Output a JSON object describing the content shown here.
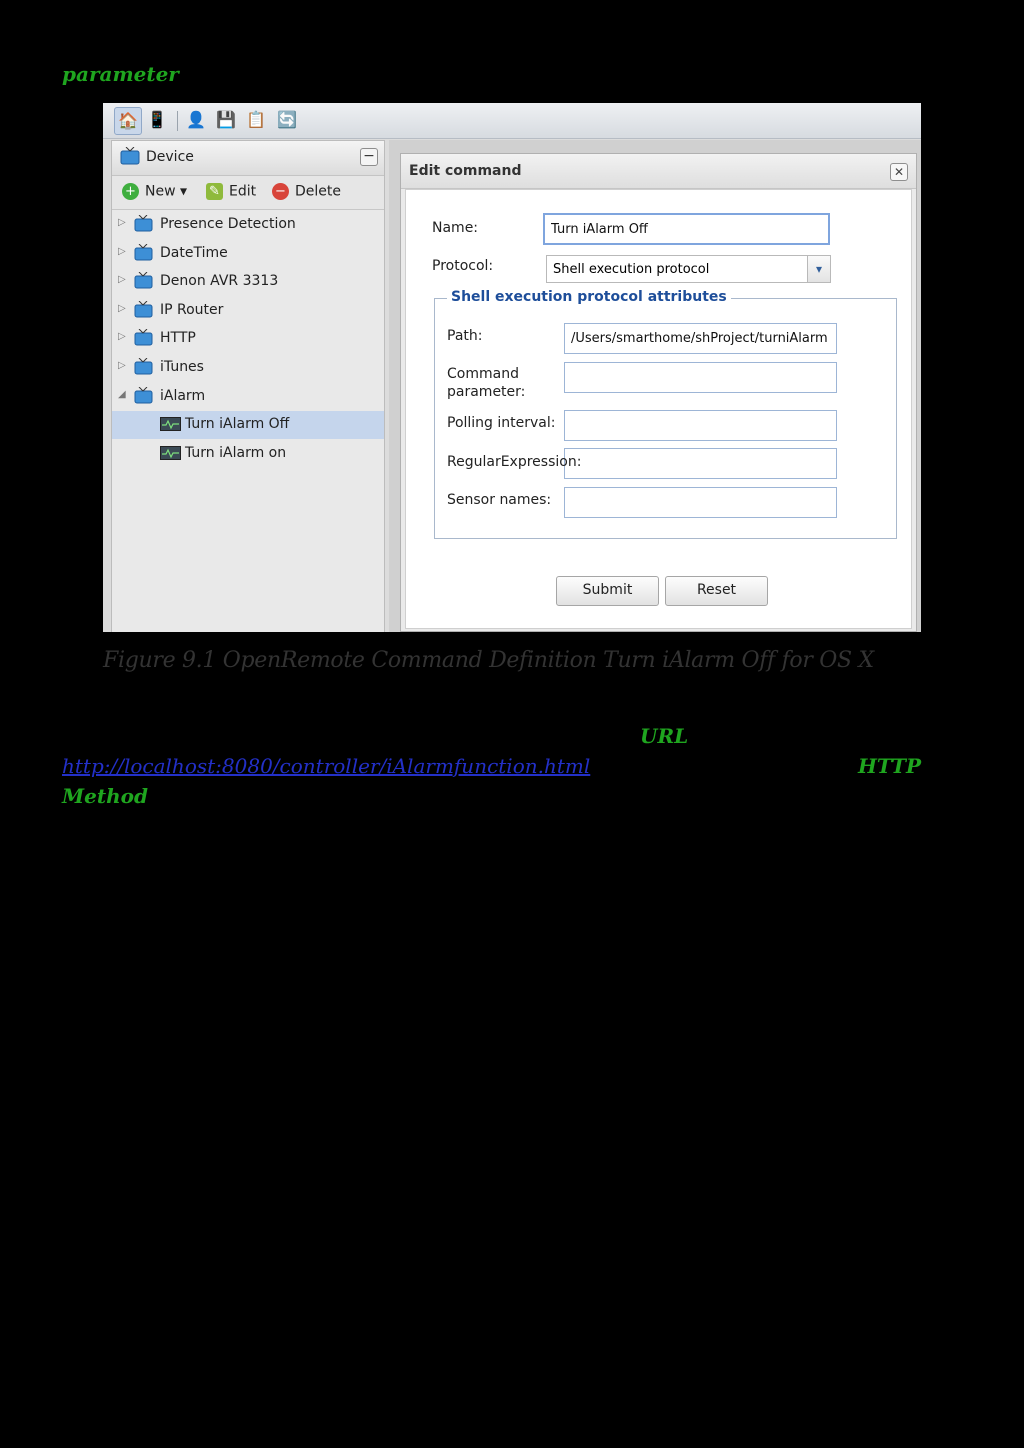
{
  "doc": {
    "top_word": "parameter",
    "caption": "Figure 9.1 OpenRemote Command Definition Turn iAlarm Off for OS X",
    "url_word": "URL",
    "link_text": "http://localhost:8080/controller/iAlarmfunction.html",
    "http_word": "HTTP",
    "method_word": "Method"
  },
  "left_panel": {
    "title": "Device",
    "actions": {
      "new": "New ▾",
      "edit": "Edit",
      "delete": "Delete"
    },
    "tree": [
      {
        "label": "Presence Detection",
        "expanded": false
      },
      {
        "label": "DateTime",
        "expanded": false
      },
      {
        "label": "Denon AVR 3313",
        "expanded": false
      },
      {
        "label": "IP Router",
        "expanded": false
      },
      {
        "label": "HTTP",
        "expanded": false
      },
      {
        "label": "iTunes",
        "expanded": false
      },
      {
        "label": "iAlarm",
        "expanded": true
      }
    ],
    "children": [
      {
        "label": "Turn iAlarm Off",
        "selected": true
      },
      {
        "label": "Turn iAlarm on",
        "selected": false
      }
    ]
  },
  "dialog": {
    "title": "Edit command",
    "name_label": "Name:",
    "name_value": "Turn iAlarm Off",
    "protocol_label": "Protocol:",
    "protocol_value": "Shell execution protocol",
    "fieldset_legend": "Shell execution protocol attributes",
    "path_label": "Path:",
    "path_value": "/Users/smarthome/shProject/turniAlarm",
    "command_param_label_1": "Command",
    "command_param_label_2": "parameter:",
    "polling_label": "Polling interval:",
    "regex_label": "RegularExpression:",
    "sensor_label": "Sensor names:",
    "submit": "Submit",
    "reset": "Reset"
  },
  "colors": {
    "green_text": "#1fa51f",
    "link": "#2330c8",
    "legend": "#1e4e9a",
    "selected_row": "#c5d5ec"
  }
}
